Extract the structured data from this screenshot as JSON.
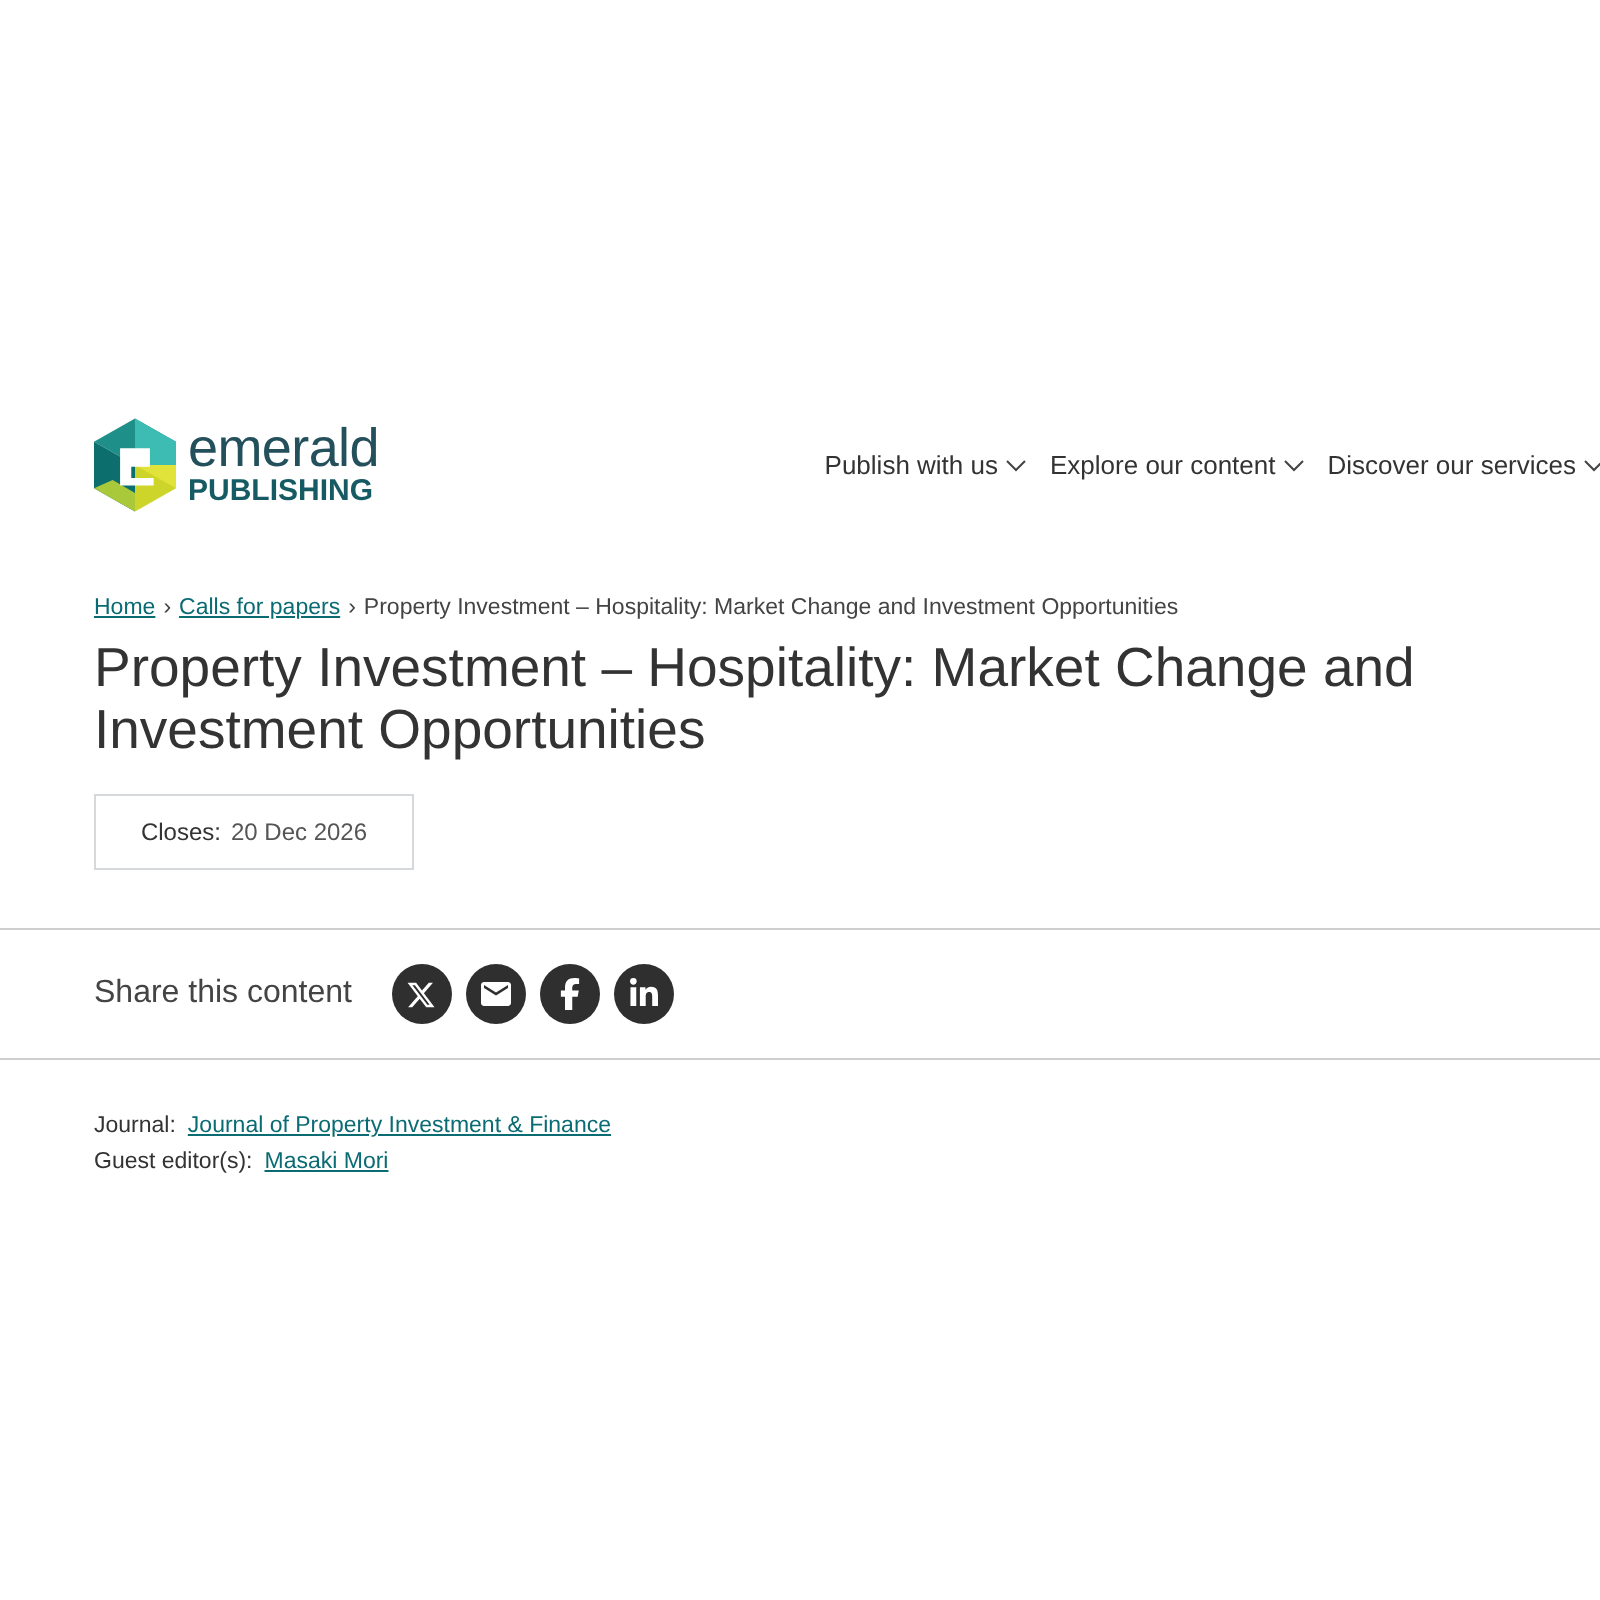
{
  "logo": {
    "wordmark": "emerald",
    "subtitle": "PUBLISHING"
  },
  "nav": [
    {
      "label": "Publish with us"
    },
    {
      "label": "Explore our content"
    },
    {
      "label": "Discover our services"
    }
  ],
  "breadcrumb": [
    {
      "label": "Home",
      "kind": "link"
    },
    {
      "label": "Calls for papers",
      "kind": "link",
      "separator": "›"
    },
    {
      "label": "Property Investment – Hospitality: Market Change and Investment Opportunities",
      "kind": "current",
      "separator": "›"
    }
  ],
  "title": "Property Investment – Hospitality: Market Change and Investment Opportunities",
  "closing": {
    "label": "Closes:",
    "value": "20 Dec 2026"
  },
  "share": {
    "label": "Share this content",
    "buttons": [
      {
        "kind": "x"
      },
      {
        "kind": "email"
      },
      {
        "kind": "facebook"
      },
      {
        "kind": "linkedin"
      }
    ]
  },
  "details": [
    {
      "label": "Journal:",
      "value": "Journal of Property Investment & Finance"
    },
    {
      "label": "Guest editor(s):",
      "value": "Masaki Mori"
    }
  ]
}
